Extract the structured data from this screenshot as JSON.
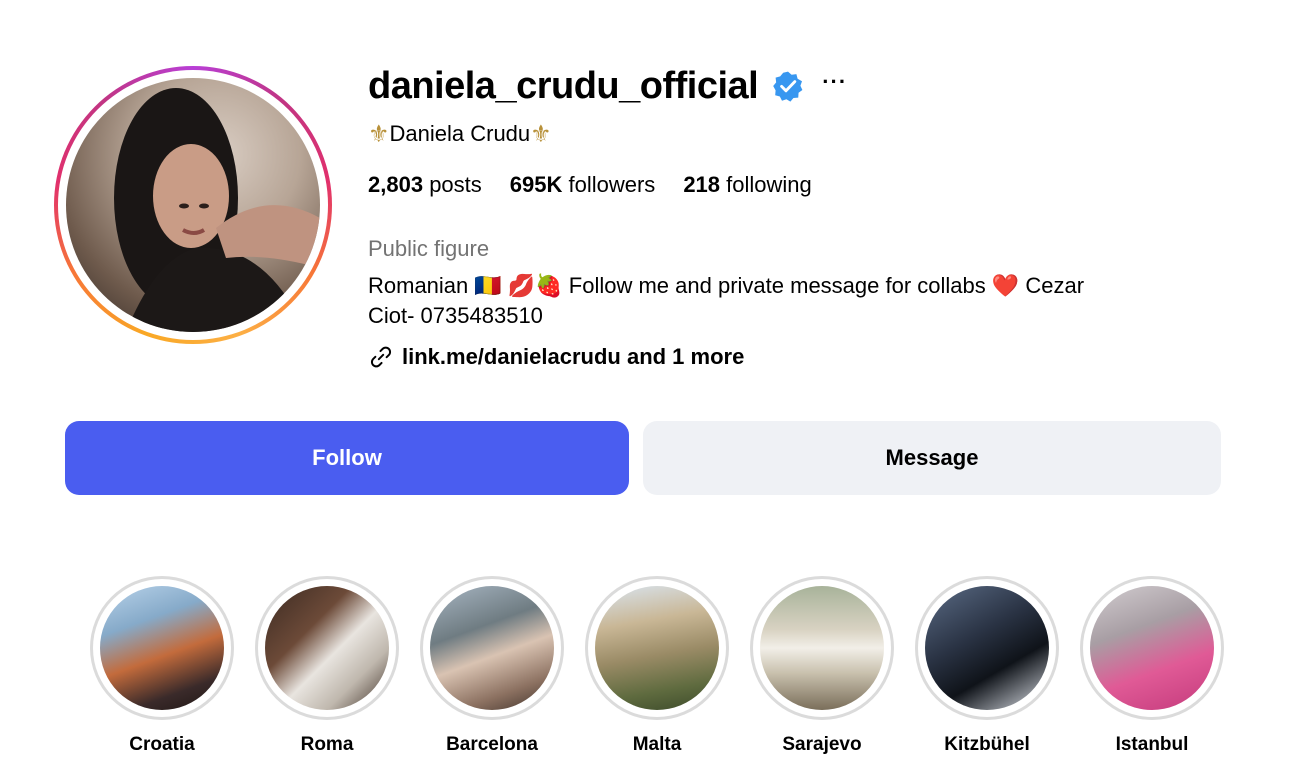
{
  "profile": {
    "username": "daniela_crudu_official",
    "verified": true,
    "more_label": "···",
    "full_name": "Daniela Crudu",
    "stats": {
      "posts_count": "2,803",
      "posts_label": "posts",
      "followers_count": "695K",
      "followers_label": "followers",
      "following_count": "218",
      "following_label": "following"
    },
    "category": "Public figure",
    "bio_line1": "Romanian 🇷🇴  💋🍓 Follow me and private message for collabs ❤️ Cezar",
    "bio_line2": "Ciot- 0735483510",
    "link_text": "link.me/danielacrudu and 1 more"
  },
  "actions": {
    "follow_label": "Follow",
    "message_label": "Message"
  },
  "highlights": [
    {
      "label": "Croatia"
    },
    {
      "label": "Roma"
    },
    {
      "label": "Barcelona"
    },
    {
      "label": "Malta"
    },
    {
      "label": "Sarajevo"
    },
    {
      "label": "Kitzbühel"
    },
    {
      "label": "Istanbul"
    }
  ],
  "colors": {
    "follow_button": "#4a5df0",
    "message_button": "#eff1f5",
    "verified_badge": "#3897f0",
    "category_text": "#737373"
  }
}
